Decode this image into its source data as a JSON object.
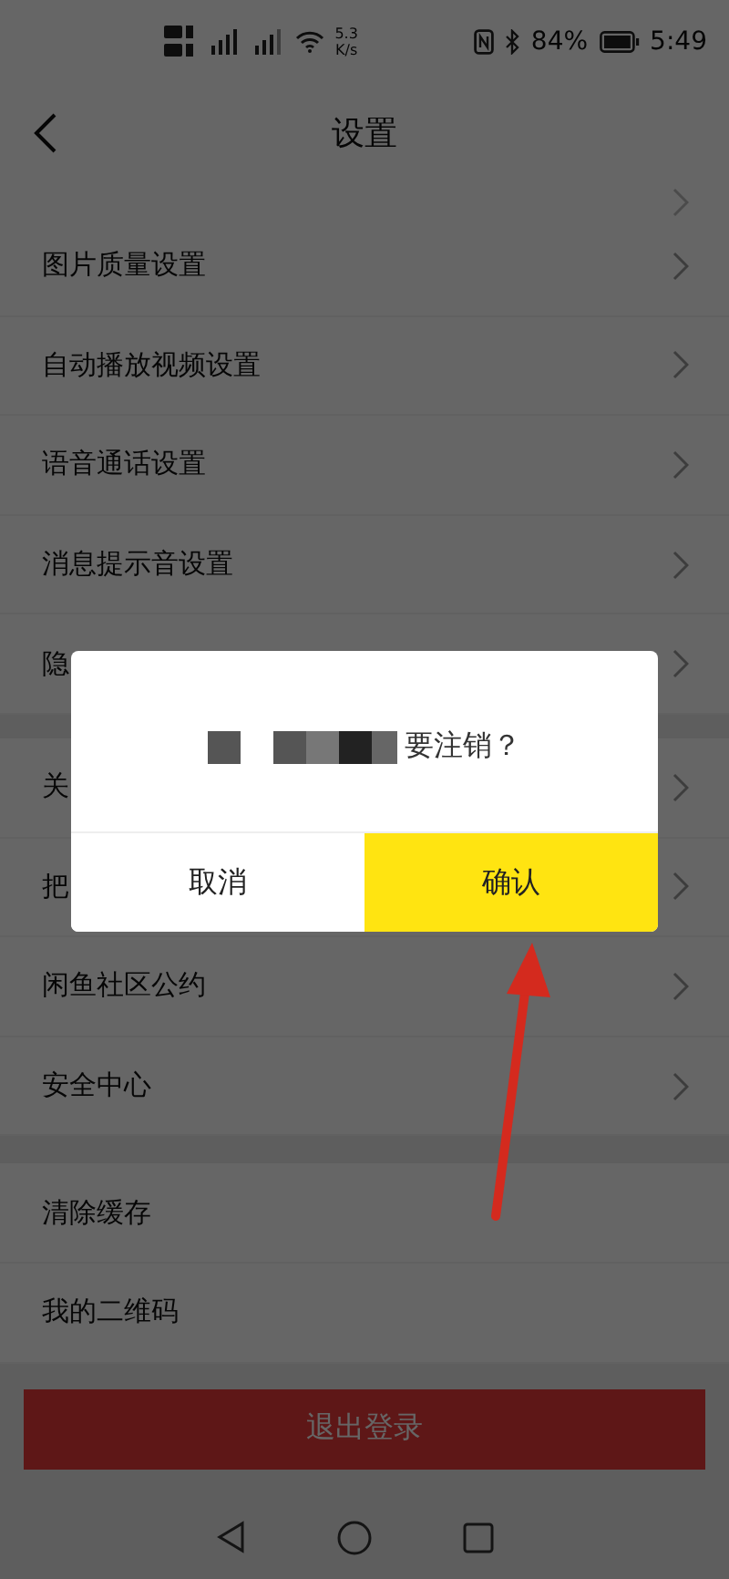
{
  "status_bar": {
    "network_speed": "5.3",
    "speed_unit": "K/s",
    "battery": "84%",
    "time": "5:49"
  },
  "header": {
    "title": "设置"
  },
  "sections": [
    {
      "items": [
        {
          "label": "图片质量设置",
          "chevron": true
        },
        {
          "label": "自动播放视频设置",
          "chevron": true
        },
        {
          "label": "语音通话设置",
          "chevron": true
        },
        {
          "label": "消息提示音设置",
          "chevron": true
        },
        {
          "label": "隐",
          "chevron": true
        }
      ]
    },
    {
      "items": [
        {
          "label": "关",
          "chevron": true
        },
        {
          "label": "把",
          "chevron": true
        },
        {
          "label": "闲鱼社区公约",
          "chevron": true
        },
        {
          "label": "安全中心",
          "chevron": true
        }
      ]
    },
    {
      "items": [
        {
          "label": "清除缓存",
          "chevron": false
        },
        {
          "label": "我的二维码",
          "chevron": false
        }
      ]
    }
  ],
  "logout_button": "退出登录",
  "dialog": {
    "message": "要注销？",
    "buttons": [
      {
        "label": "取消",
        "kind": "cancel"
      },
      {
        "label": "确认",
        "kind": "confirm"
      }
    ]
  }
}
